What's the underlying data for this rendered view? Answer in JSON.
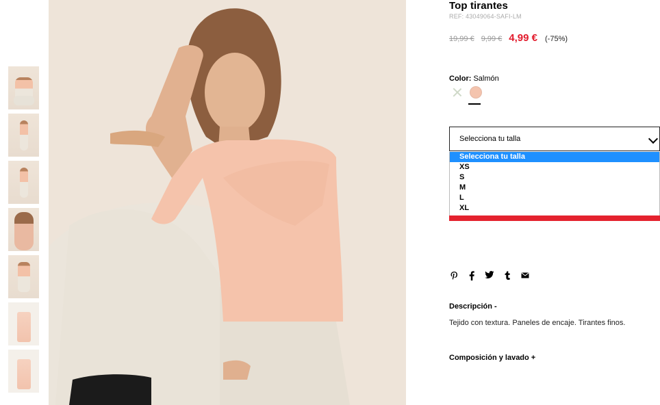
{
  "product": {
    "title": "Top tirantes",
    "ref": "REF: 43049064-SAFI-LM",
    "price_original": "19,99 €",
    "price_previous": "9,99 €",
    "price_current": "4,99 €",
    "discount": "(-75%)",
    "color_label": "Color:",
    "color_value": "Salmón"
  },
  "size": {
    "select_label": "Selecciona tu talla",
    "options": [
      "Selecciona tu talla",
      "XS",
      "S",
      "M",
      "L",
      "XL"
    ]
  },
  "details": {
    "description_heading": "Descripción -",
    "description_text": "Tejido con textura. Paneles de encaje. Tirantes finos.",
    "composition_heading": "Composición y lavado +"
  },
  "share_icons": [
    "pinterest-icon",
    "facebook-icon",
    "twitter-icon",
    "tumblr-icon",
    "email-icon"
  ],
  "colors": {
    "accent": "#e21b2c",
    "swatch": "#f4c4ae",
    "option_selected": "#1e90ff"
  }
}
